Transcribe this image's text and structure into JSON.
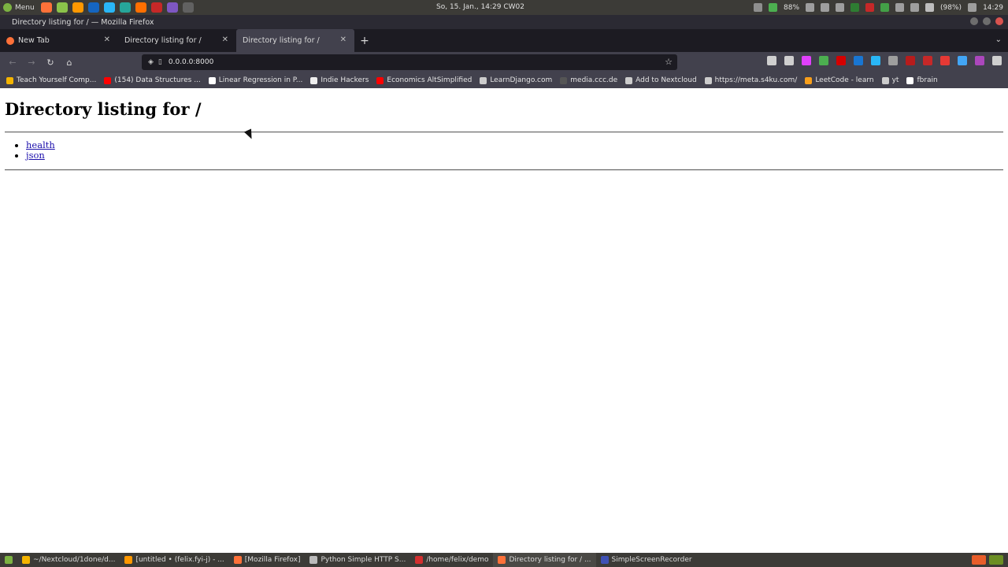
{
  "desktop_panel": {
    "menu_label": "Menu",
    "clock": "So, 15. Jan., 14:29  CW02",
    "battery_indicator": "88%",
    "battery_percent": "(98%)",
    "time": "14:29"
  },
  "window": {
    "title": "Directory listing for / — Mozilla Firefox"
  },
  "tabs": [
    {
      "label": "New Tab",
      "active": false
    },
    {
      "label": "Directory listing for /",
      "active": false
    },
    {
      "label": "Directory listing for /",
      "active": true
    }
  ],
  "nav": {
    "url": "0.0.0.0:8000"
  },
  "bookmarks": [
    {
      "label": "Teach Yourself Comp...",
      "icon_color": "#f4b400"
    },
    {
      "label": "(154) Data Structures ...",
      "icon_color": "#ff0000"
    },
    {
      "label": "Linear Regression in P...",
      "icon_color": "#ffffff"
    },
    {
      "label": "Indie Hackers",
      "icon_color": "#eeeeee"
    },
    {
      "label": "Economics AltSimplified",
      "icon_color": "#ff0000"
    },
    {
      "label": "LearnDjango.com",
      "icon_color": "#cccccc"
    },
    {
      "label": "media.ccc.de",
      "icon_color": "#555555"
    },
    {
      "label": "Add to Nextcloud",
      "icon_color": "#cccccc"
    },
    {
      "label": "https://meta.s4ku.com/",
      "icon_color": "#cccccc"
    },
    {
      "label": "LeetCode - learn",
      "icon_color": "#f89f1b"
    },
    {
      "label": "yt",
      "icon_color": "#cccccc"
    },
    {
      "label": "fbrain",
      "icon_color": "#ffffff"
    }
  ],
  "page": {
    "heading": "Directory listing for /",
    "entries": [
      "health",
      "json"
    ]
  },
  "taskbar": [
    {
      "label": "~/Nextcloud/1done/d...",
      "icon_color": "#f4b400"
    },
    {
      "label": "[untitled • (felix.fyi-j) - ...",
      "icon_color": "#ff9800"
    },
    {
      "label": "[Mozilla Firefox]",
      "icon_color": "#ff7139"
    },
    {
      "label": "Python Simple HTTP S...",
      "icon_color": "#bbbbbb"
    },
    {
      "label": "/home/felix/demo",
      "icon_color": "#d32f2f"
    },
    {
      "label": "Directory listing for / ...",
      "icon_color": "#ff7139"
    },
    {
      "label": "SimpleScreenRecorder",
      "icon_color": "#3f51b5"
    }
  ]
}
